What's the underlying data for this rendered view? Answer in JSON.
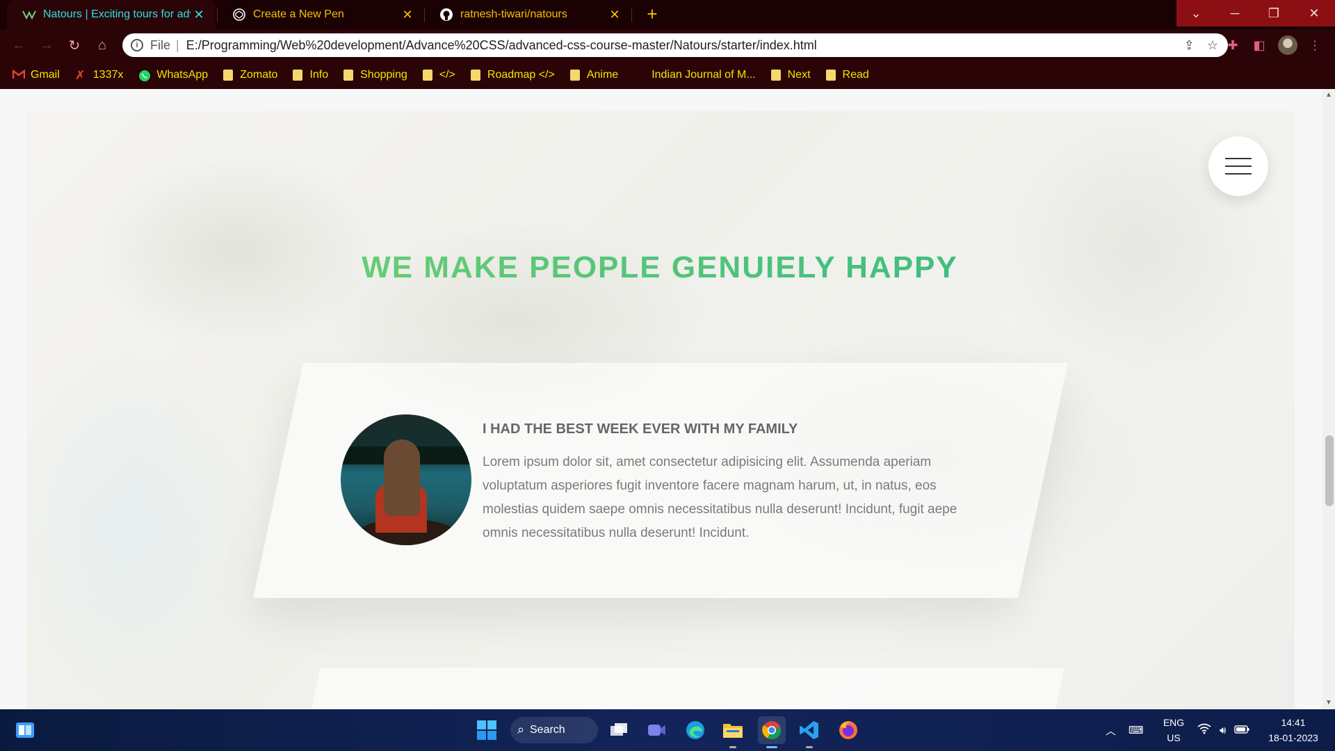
{
  "browser": {
    "tabs": [
      {
        "title": "Natours | Exciting tours for adventurous people",
        "active": true,
        "icon": "natours-leaf-icon"
      },
      {
        "title": "Create a New Pen",
        "active": false,
        "icon": "codepen-icon"
      },
      {
        "title": "ratnesh-tiwari/natours",
        "active": false,
        "icon": "github-icon"
      }
    ],
    "address": {
      "scheme": "File",
      "url": "E:/Programming/Web%20development/Advance%20CSS/advanced-css-course-master/Natours/starter/index.html"
    },
    "bookmarks": [
      {
        "label": "Gmail",
        "icon": "gmail-icon"
      },
      {
        "label": "1337x",
        "icon": "x-icon"
      },
      {
        "label": "WhatsApp",
        "icon": "whatsapp-icon"
      },
      {
        "label": "Zomato",
        "icon": "folder-icon"
      },
      {
        "label": "Info",
        "icon": "folder-icon"
      },
      {
        "label": "Shopping",
        "icon": "folder-icon"
      },
      {
        "label": "</>",
        "icon": "folder-icon"
      },
      {
        "label": "Roadmap </>",
        "icon": "folder-icon"
      },
      {
        "label": "Anime",
        "icon": "folder-icon"
      },
      {
        "label": "Indian Journal of M...",
        "icon": "none"
      },
      {
        "label": "Next",
        "icon": "folder-icon"
      },
      {
        "label": "Read",
        "icon": "folder-icon"
      }
    ]
  },
  "page": {
    "heading": "WE MAKE PEOPLE GENUIELY HAPPY",
    "story": {
      "title": "I HAD THE BEST WEEK EVER WITH MY FAMILY",
      "text": "Lorem ipsum dolor sit, amet consectetur adipisicing elit. Assumenda aperiam voluptatum asperiores fugit inventore facere magnam harum, ut, in natus, eos molestias quidem saepe omnis necessitatibus nulla deserunt! Incidunt, fugit aepe omnis necessitatibus nulla deserunt! Incidunt."
    },
    "colors": {
      "heading_start": "#7ed56f",
      "heading_end": "#28b485"
    }
  },
  "taskbar": {
    "search_label": "Search",
    "language": "ENG",
    "region": "US",
    "time": "14:41",
    "date": "18-01-2023"
  }
}
